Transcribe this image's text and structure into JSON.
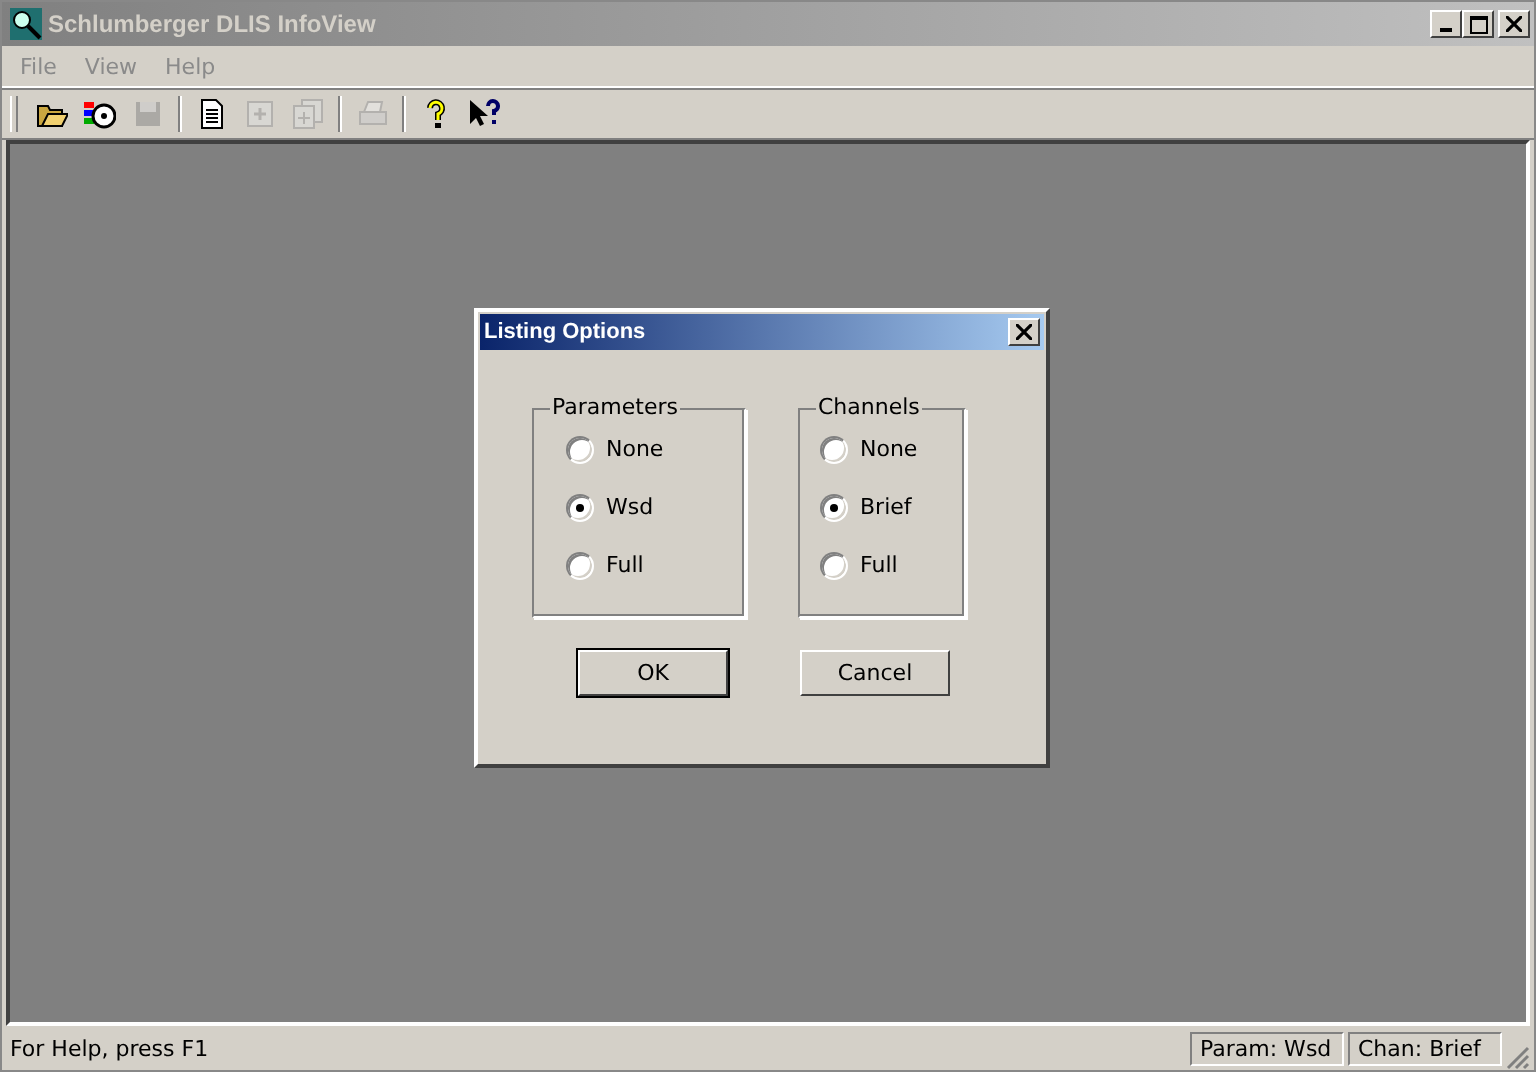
{
  "window": {
    "title": "Schlumberger DLIS InfoView",
    "active": false
  },
  "menu": [
    "File",
    "View",
    "Help"
  ],
  "toolbar": [
    {
      "disabled": false
    },
    {
      "disabled": false
    },
    {
      "disabled": true
    },
    {
      "disabled": false
    },
    {
      "disabled": true
    },
    {
      "disabled": true
    },
    {
      "disabled": true
    },
    {
      "disabled": false
    },
    {
      "disabled": false
    }
  ],
  "dialog": {
    "title": "Listing Options",
    "groups": [
      {
        "label": "Parameters",
        "options": [
          {
            "label": "None",
            "selected": false
          },
          {
            "label": "Wsd",
            "selected": true
          },
          {
            "label": "Full",
            "selected": false
          }
        ]
      },
      {
        "label": "Channels",
        "options": [
          {
            "label": "None",
            "selected": false
          },
          {
            "label": "Brief",
            "selected": true
          },
          {
            "label": "Full",
            "selected": false
          }
        ]
      }
    ],
    "buttons": [
      {
        "label": "OK",
        "default": true
      },
      {
        "label": "Cancel",
        "default": false
      }
    ]
  },
  "status_bar": {
    "message": "For Help, press F1",
    "panes": [
      "Param: Wsd",
      "Chan: Brief"
    ]
  }
}
